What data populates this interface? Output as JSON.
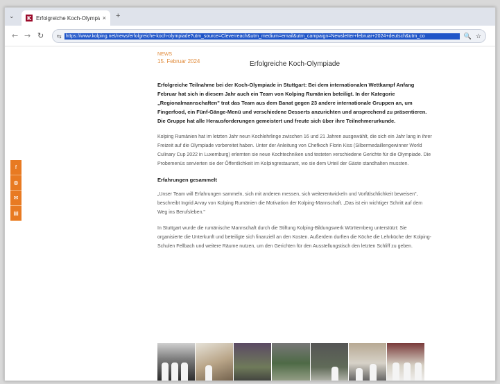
{
  "browser": {
    "tab": {
      "title": "Erfolgreiche Koch-Olympiade",
      "favicon_letter": "K",
      "close_glyph": "×"
    },
    "new_tab_glyph": "+",
    "tab_menu_glyph": "⌄",
    "back_glyph": "←",
    "forward_glyph": "→",
    "reload_glyph": "↻",
    "site_info_glyph": "⇆",
    "url": "https://www.kolping.net/news/erfolgreiche-koch-olympiade?utm_source=Cleverreach&utm_medium=email&utm_campaign=Newsletter+februar+2024+deutsch&utm_co",
    "zoom_glyph": "🔍",
    "star_glyph": "☆"
  },
  "article": {
    "category": "NEWS",
    "date": "15. Februar 2024",
    "title": "Erfolgreiche Koch-Olympiade",
    "lead": "Erfolgreiche Teilnahme bei der Koch-Olympiade in Stuttgart: Bei dem internationalen Wettkampf Anfang Februar hat sich in diesem Jahr auch ein Team von Kolping Rumänien beteiligt. In der Kategorie „Regionalmannschaften\" trat das Team aus dem Banat gegen 23 andere internationale Gruppen an, um Fingerfood, ein Fünf-Gänge-Menü und verschiedene Desserts anzurichten und ansprechend zu präsentieren. Die Gruppe hat alle Herausforderungen gemeistert und freute sich über ihre Teilnehmerurkunde.",
    "para1": "Kolping Rumänien hat im letzten Jahr neun Kochlehrlinge zwischen 16 und 21 Jahren ausgewählt, die sich ein Jahr lang in ihrer Freizeit auf die Olympiade vorbereitet haben. Unter der Anleitung von Chefkoch Florin Kiss (Silbermedaillengewinner World Culinary Cup 2022 in Luxemburg) erlernten sie neue Kochtechniken und testeten verschiedene Gerichte für die Olympiade. Die Probemenüs servierten sie der Öffentlichkeit im Kolpingrestaurant, wo sie dem Urteil der Gäste standhalten mussten.",
    "subhead": "Erfahrungen gesammelt",
    "para2": "„Unser Team will Erfahrungen sammeln, sich mit anderen messen, sich weiterentwickeln und Vorfälschlichkeit beweisen\", beschreibt Ingrid Arvay von Kolping Rumänien die Motivation der Kolping-Mannschaft. „Das ist ein wichtiger Schritt auf dem Weg ins Berufsleben.\"",
    "para3": "In Stuttgart wurde die rumänische Mannschaft durch die Stiftung Kolping-Bildungswerk Württemberg unterstützt: Sie organisierte die Unterkunft und beteiligte sich finanziell an den Kosten. Außerdem durften die Köche die Lehrküche der Kolping-Schulen Fellbach und weitere Räume nutzen, um den Gerichten für den Ausstellungstisch den letzten Schliff zu geben."
  },
  "social": [
    {
      "icon": "facebook-icon",
      "glyph": "f"
    },
    {
      "icon": "share-icon",
      "glyph": "◍"
    },
    {
      "icon": "mail-icon",
      "glyph": "✉"
    },
    {
      "icon": "print-icon",
      "glyph": "▤"
    }
  ],
  "colors": {
    "accent": "#e87a22",
    "brand": "#9b0a2a",
    "url_highlight": "#1f55c8"
  }
}
